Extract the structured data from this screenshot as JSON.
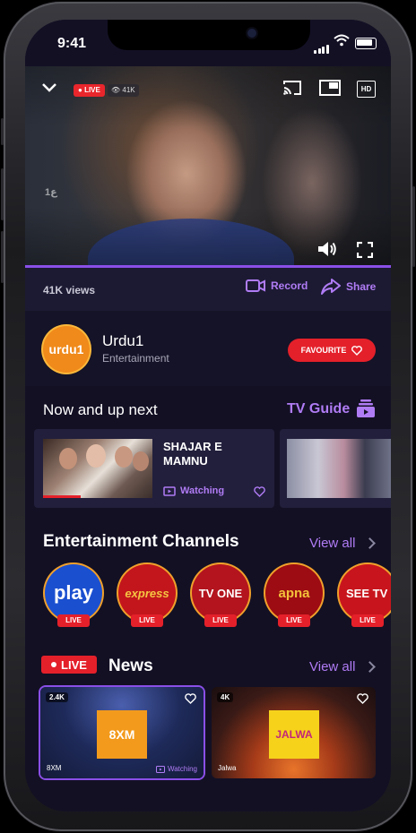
{
  "status_bar": {
    "time": "9:41"
  },
  "player": {
    "live_label": "LIVE",
    "viewers": "41K",
    "watermark": "1ع",
    "quality": "HD",
    "views_text": "41K views",
    "record_label": "Record",
    "share_label": "Share"
  },
  "channel": {
    "logo_text": "urdu1",
    "name": "Urdu1",
    "category": "Entertainment",
    "favourite_label": "FAVOURITE"
  },
  "now_next": {
    "title": "Now and up next",
    "tv_guide_label": "TV Guide",
    "current": {
      "title": "SHAJAR E MAMNU",
      "watching_label": "Watching"
    }
  },
  "entertainment": {
    "title": "Entertainment Channels",
    "view_all": "View all",
    "channels": [
      {
        "name": "play",
        "live": "LIVE",
        "color": "#1a4fd0"
      },
      {
        "name": "express",
        "live": "LIVE",
        "color": "#c2161c"
      },
      {
        "name": "TV ONE",
        "live": "LIVE",
        "color": "#b3141e"
      },
      {
        "name": "apna",
        "live": "LIVE",
        "color": "#9c0c12"
      },
      {
        "name": "SEE TV",
        "live": "LIVE",
        "color": "#c8151d"
      }
    ]
  },
  "news": {
    "live_badge": "LIVE",
    "title": "News",
    "view_all": "View all",
    "cards": [
      {
        "count": "2.4K",
        "logo": "8XM",
        "caption": "8XM",
        "watching": "Watching"
      },
      {
        "count": "4K",
        "logo": "JALWA",
        "caption": "Jalwa"
      }
    ]
  },
  "colors": {
    "accent": "#b07cf5",
    "live_red": "#e4202a",
    "background": "#131024"
  }
}
